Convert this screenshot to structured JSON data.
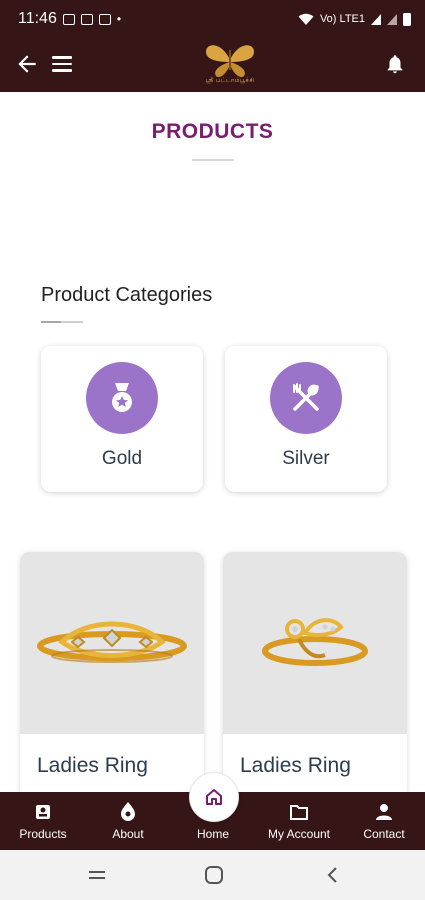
{
  "status_bar": {
    "time": "11:46",
    "dot": "•",
    "network_label": "Vo) LTE1"
  },
  "app_bar": {
    "logo_caption": "ஸ்ரீ பட்டாம்பூச்சி"
  },
  "page": {
    "title": "PRODUCTS"
  },
  "categories": {
    "section_title": "Product Categories",
    "items": [
      {
        "label": "Gold",
        "icon": "medal-icon",
        "color": "#9b73c9"
      },
      {
        "label": "Silver",
        "icon": "utensils-icon",
        "color": "#9b73c9"
      }
    ]
  },
  "products": [
    {
      "name": "Ladies Ring"
    },
    {
      "name": "Ladies Ring"
    }
  ],
  "bottom_nav": {
    "items": [
      {
        "label": "Products",
        "icon": "products-icon"
      },
      {
        "label": "About",
        "icon": "about-icon"
      },
      {
        "label": "Home",
        "icon": "home-icon"
      },
      {
        "label": "My Account",
        "icon": "folder-icon"
      },
      {
        "label": "Contact",
        "icon": "person-icon"
      }
    ]
  },
  "colors": {
    "header_bg": "#351515",
    "title_color": "#7a1d72",
    "category_icon_bg": "#9b73c9",
    "logo_gold": "#d9a441"
  }
}
